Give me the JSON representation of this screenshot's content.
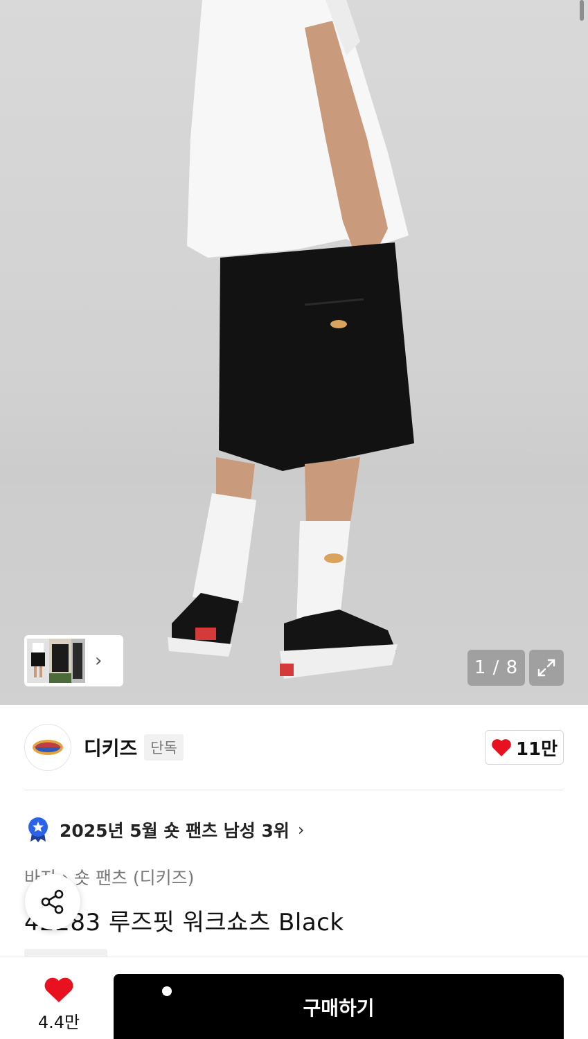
{
  "gallery": {
    "counter": "1 / 8",
    "thumb_chevron": "›",
    "expand_icon": "expand-icon"
  },
  "brand": {
    "logo_text": "Dickies",
    "name": "디키즈",
    "badge": "단독",
    "likes": "11만"
  },
  "ranking": {
    "text": "2025년 5월 숏 팬츠 남성 3위",
    "chevron": "›"
  },
  "breadcrumb": {
    "level1": "바지",
    "separator": "›",
    "level2": "숏 팬츠 (디키즈)"
  },
  "product": {
    "title": "42283 루즈핏 워크쇼츠 Black"
  },
  "bottom_bar": {
    "wish_count": "4.4만",
    "buy_label": "구매하기"
  },
  "colors": {
    "heart": "#e8111f",
    "buy_button": "#000000",
    "rank_badge": "#2b63e8"
  }
}
